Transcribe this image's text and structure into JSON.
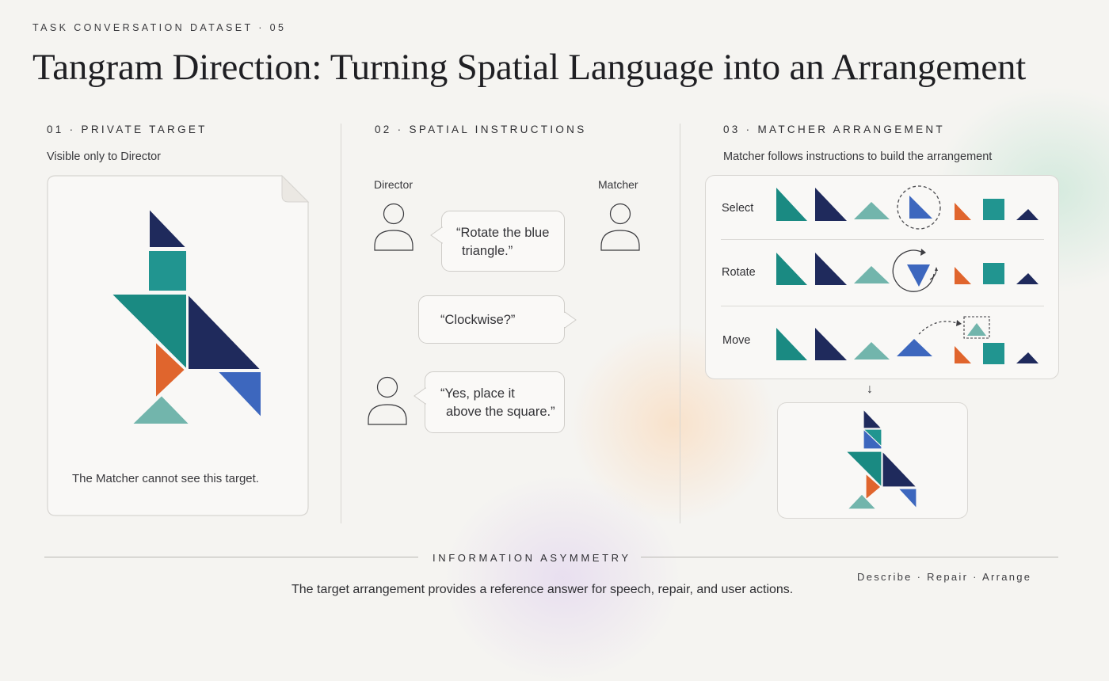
{
  "header": {
    "kicker": "TASK CONVERSATION DATASET · 05",
    "title": "Tangram Direction: Turning Spatial Language into an Arrangement"
  },
  "sections": {
    "private_target": {
      "heading": "01 · PRIVATE TARGET",
      "subtitle": "Visible only to Director",
      "note": "The Matcher cannot see this target."
    },
    "spatial_instructions": {
      "heading": "02 · SPATIAL INSTRUCTIONS",
      "director_label": "Director",
      "matcher_label": "Matcher",
      "messages": [
        {
          "speaker": "Director",
          "line1": "“Rotate the blue",
          "line2": "triangle.”"
        },
        {
          "speaker": "Matcher",
          "line1": "“Clockwise?”"
        },
        {
          "speaker": "Director",
          "line1": "“Yes, place it",
          "line2": "above the square.”"
        }
      ]
    },
    "matcher_arrangement": {
      "heading": "03 · MATCHER ARRANGEMENT",
      "subtitle": "Matcher follows instructions to build the arrangement",
      "steps": [
        "Select",
        "Rotate",
        "Move"
      ],
      "arrow": "↓"
    }
  },
  "footer": {
    "heading": "INFORMATION ASYMMETRY",
    "caption": "The target arrangement provides a reference answer for speech, repair, and user actions.",
    "tags": "Describe · Repair · Arrange"
  },
  "colors": {
    "navy": "#1f2a5c",
    "teal_dark": "#1a8a82",
    "teal": "#219590",
    "teal_light": "#72b5ac",
    "orange": "#e0652d",
    "blue": "#3d67be"
  }
}
